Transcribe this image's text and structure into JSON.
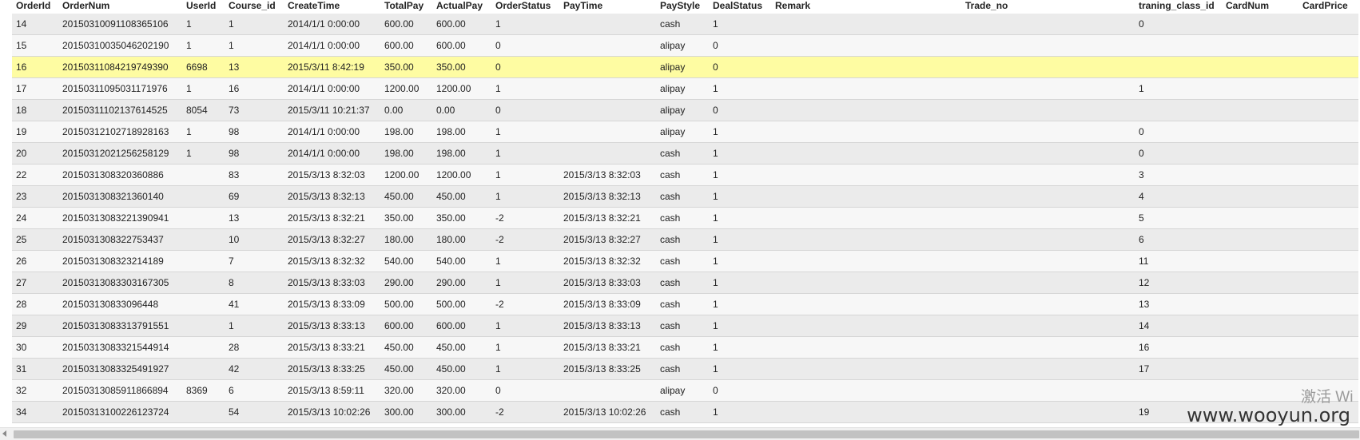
{
  "columns": [
    "OrderId",
    "OrderNum",
    "UserId",
    "Course_id",
    "CreateTime",
    "TotalPay",
    "ActualPay",
    "OrderStatus",
    "PayTime",
    "PayStyle",
    "DealStatus",
    "Remark",
    "Trade_no",
    "traning_class_id",
    "CardNum",
    "CardPrice"
  ],
  "rows": [
    [
      "14",
      "2015031009110836510​6",
      "1",
      "1",
      "2014/1/1 0:00:00",
      "600.00",
      "600.00",
      "1",
      "",
      "cash",
      "1",
      "",
      "",
      "0",
      "",
      ""
    ],
    [
      "15",
      "20150310035046202190",
      "1",
      "1",
      "2014/1/1 0:00:00",
      "600.00",
      "600.00",
      "0",
      "",
      "alipay",
      "0",
      "",
      "",
      "",
      "",
      ""
    ],
    [
      "16",
      "20150311084219749390",
      "6698",
      "13",
      "2015/3/11 8:42:19",
      "350.00",
      "350.00",
      "0",
      "",
      "alipay",
      "0",
      "",
      "",
      "",
      "",
      ""
    ],
    [
      "17",
      "20150311095031171976",
      "1",
      "16",
      "2014/1/1 0:00:00",
      "1200.00",
      "1200.00",
      "1",
      "",
      "alipay",
      "1",
      "",
      "",
      "1",
      "",
      ""
    ],
    [
      "18",
      "20150311102137614525",
      "8054",
      "73",
      "2015/3/11 10:21:37",
      "0.00",
      "0.00",
      "0",
      "",
      "alipay",
      "0",
      "",
      "",
      "",
      "",
      ""
    ],
    [
      "19",
      "20150312102718928163",
      "1",
      "98",
      "2014/1/1 0:00:00",
      "198.00",
      "198.00",
      "1",
      "",
      "alipay",
      "1",
      "",
      "",
      "0",
      "",
      ""
    ],
    [
      "20",
      "20150312021256258129",
      "1",
      "98",
      "2014/1/1 0:00:00",
      "198.00",
      "198.00",
      "1",
      "",
      "cash",
      "1",
      "",
      "",
      "0",
      "",
      ""
    ],
    [
      "22",
      "201503130832036088​6",
      "",
      "83",
      "2015/3/13 8:32:03",
      "1200.00",
      "1200.00",
      "1",
      "2015/3/13 8:32:03",
      "cash",
      "1",
      "",
      "",
      "3",
      "",
      ""
    ],
    [
      "23",
      "201503130832136014​0",
      "",
      "69",
      "2015/3/13 8:32:13",
      "450.00",
      "450.00",
      "1",
      "2015/3/13 8:32:13",
      "cash",
      "1",
      "",
      "",
      "4",
      "",
      ""
    ],
    [
      "24",
      "20150313083221390941",
      "",
      "13",
      "2015/3/13 8:32:21",
      "350.00",
      "350.00",
      "-2",
      "2015/3/13 8:32:21",
      "cash",
      "1",
      "",
      "",
      "5",
      "",
      ""
    ],
    [
      "25",
      "201503130832275343​7",
      "",
      "10",
      "2015/3/13 8:32:27",
      "180.00",
      "180.00",
      "-2",
      "2015/3/13 8:32:27",
      "cash",
      "1",
      "",
      "",
      "6",
      "",
      ""
    ],
    [
      "26",
      "201503130832321418​9",
      "",
      "7",
      "2015/3/13 8:32:32",
      "540.00",
      "540.00",
      "1",
      "2015/3/13 8:32:32",
      "cash",
      "1",
      "",
      "",
      "11",
      "",
      ""
    ],
    [
      "27",
      "20150313083303167305",
      "",
      "8",
      "2015/3/13 8:33:03",
      "290.00",
      "290.00",
      "1",
      "2015/3/13 8:33:03",
      "cash",
      "1",
      "",
      "",
      "12",
      "",
      ""
    ],
    [
      "28",
      "201503130833096448",
      "",
      "41",
      "2015/3/13 8:33:09",
      "500.00",
      "500.00",
      "-2",
      "2015/3/13 8:33:09",
      "cash",
      "1",
      "",
      "",
      "13",
      "",
      ""
    ],
    [
      "29",
      "20150313083313791551",
      "",
      "1",
      "2015/3/13 8:33:13",
      "600.00",
      "600.00",
      "1",
      "2015/3/13 8:33:13",
      "cash",
      "1",
      "",
      "",
      "14",
      "",
      ""
    ],
    [
      "30",
      "20150313083321544914",
      "",
      "28",
      "2015/3/13 8:33:21",
      "450.00",
      "450.00",
      "1",
      "2015/3/13 8:33:21",
      "cash",
      "1",
      "",
      "",
      "16",
      "",
      ""
    ],
    [
      "31",
      "20150313083325491927",
      "",
      "42",
      "2015/3/13 8:33:25",
      "450.00",
      "450.00",
      "1",
      "2015/3/13 8:33:25",
      "cash",
      "1",
      "",
      "",
      "17",
      "",
      ""
    ],
    [
      "32",
      "20150313085911866894",
      "8369",
      "6",
      "2015/3/13 8:59:11",
      "320.00",
      "320.00",
      "0",
      "",
      "alipay",
      "0",
      "",
      "",
      "",
      "",
      ""
    ],
    [
      "34",
      "20150313100226123724",
      "",
      "54",
      "2015/3/13 10:02:26",
      "300.00",
      "300.00",
      "-2",
      "2015/3/13 10:02:26",
      "cash",
      "1",
      "",
      "",
      "19",
      "",
      ""
    ]
  ],
  "selected_row_index": 2,
  "overlay": {
    "activate_text": "激活 Wi",
    "watermark": "www.wooyun.org"
  },
  "colors": {
    "row_odd": "#ebebeb",
    "row_even": "#f7f7f7",
    "row_selected": "#fefca2"
  }
}
